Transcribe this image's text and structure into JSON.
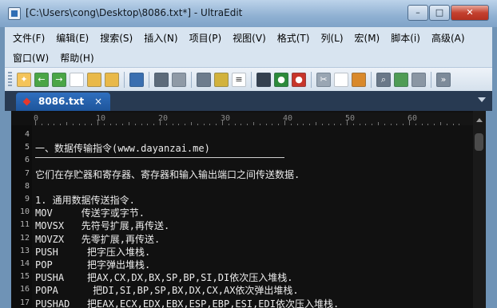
{
  "window": {
    "title": "[C:\\Users\\cong\\Desktop\\8086.txt*] - UltraEdit",
    "min_glyph": "–",
    "max_glyph": "□",
    "close_glyph": "✕"
  },
  "menu": {
    "row1": [
      "文件(F)",
      "编辑(E)",
      "搜索(S)",
      "插入(N)",
      "项目(P)",
      "视图(V)",
      "格式(T)",
      "列(L)",
      "宏(M)",
      "脚本(i)",
      "高级(A)"
    ],
    "row2": [
      "窗口(W)",
      "帮助(H)"
    ]
  },
  "toolbar": {
    "icons": [
      "new-file-icon",
      "back-icon",
      "forward-icon",
      "blank-page-icon",
      "open-folder-icon",
      "open-folder-2-icon",
      "save-icon",
      "print-icon",
      "print-preview-icon",
      "ftp-icon",
      "column-mode-icon",
      "word-wrap-icon",
      "dark-theme-icon",
      "compile-icon",
      "browser-icon",
      "cut-icon",
      "copy-icon",
      "paste-icon",
      "find-icon",
      "replace-icon",
      "find-in-files-icon",
      "more-icon"
    ]
  },
  "tab": {
    "label": "8086.txt",
    "close": "×"
  },
  "ruler": {
    "labels": [
      "0",
      "10",
      "20",
      "30",
      "40",
      "50",
      "60"
    ]
  },
  "editor": {
    "lines": [
      {
        "n": "4",
        "text": ""
      },
      {
        "n": "5",
        "text": "一、数据传输指令(www.dayanzai.me)"
      },
      {
        "n": "6",
        "text": ""
      },
      {
        "n": "7",
        "text": "它们在存贮器和寄存器、寄存器和输入输出端口之间传送数据."
      },
      {
        "n": "8",
        "text": ""
      },
      {
        "n": "9",
        "text": "1. 通用数据传送指令."
      },
      {
        "n": "10",
        "text": "MOV     传送字或字节."
      },
      {
        "n": "11",
        "text": "MOVSX   先符号扩展,再传送."
      },
      {
        "n": "12",
        "text": "MOVZX   先零扩展,再传送."
      },
      {
        "n": "13",
        "text": "PUSH     把字压入堆栈."
      },
      {
        "n": "14",
        "text": "POP      把字弹出堆栈."
      },
      {
        "n": "15",
        "text": "PUSHA    把AX,CX,DX,BX,SP,BP,SI,DI依次压入堆栈."
      },
      {
        "n": "16",
        "text": "POPA      把DI,SI,BP,SP,BX,DX,CX,AX依次弹出堆栈."
      },
      {
        "n": "17",
        "text": "PUSHAD   把EAX,ECX,EDX,EBX,ESP,EBP,ESI,EDI依次压入堆栈."
      }
    ]
  }
}
